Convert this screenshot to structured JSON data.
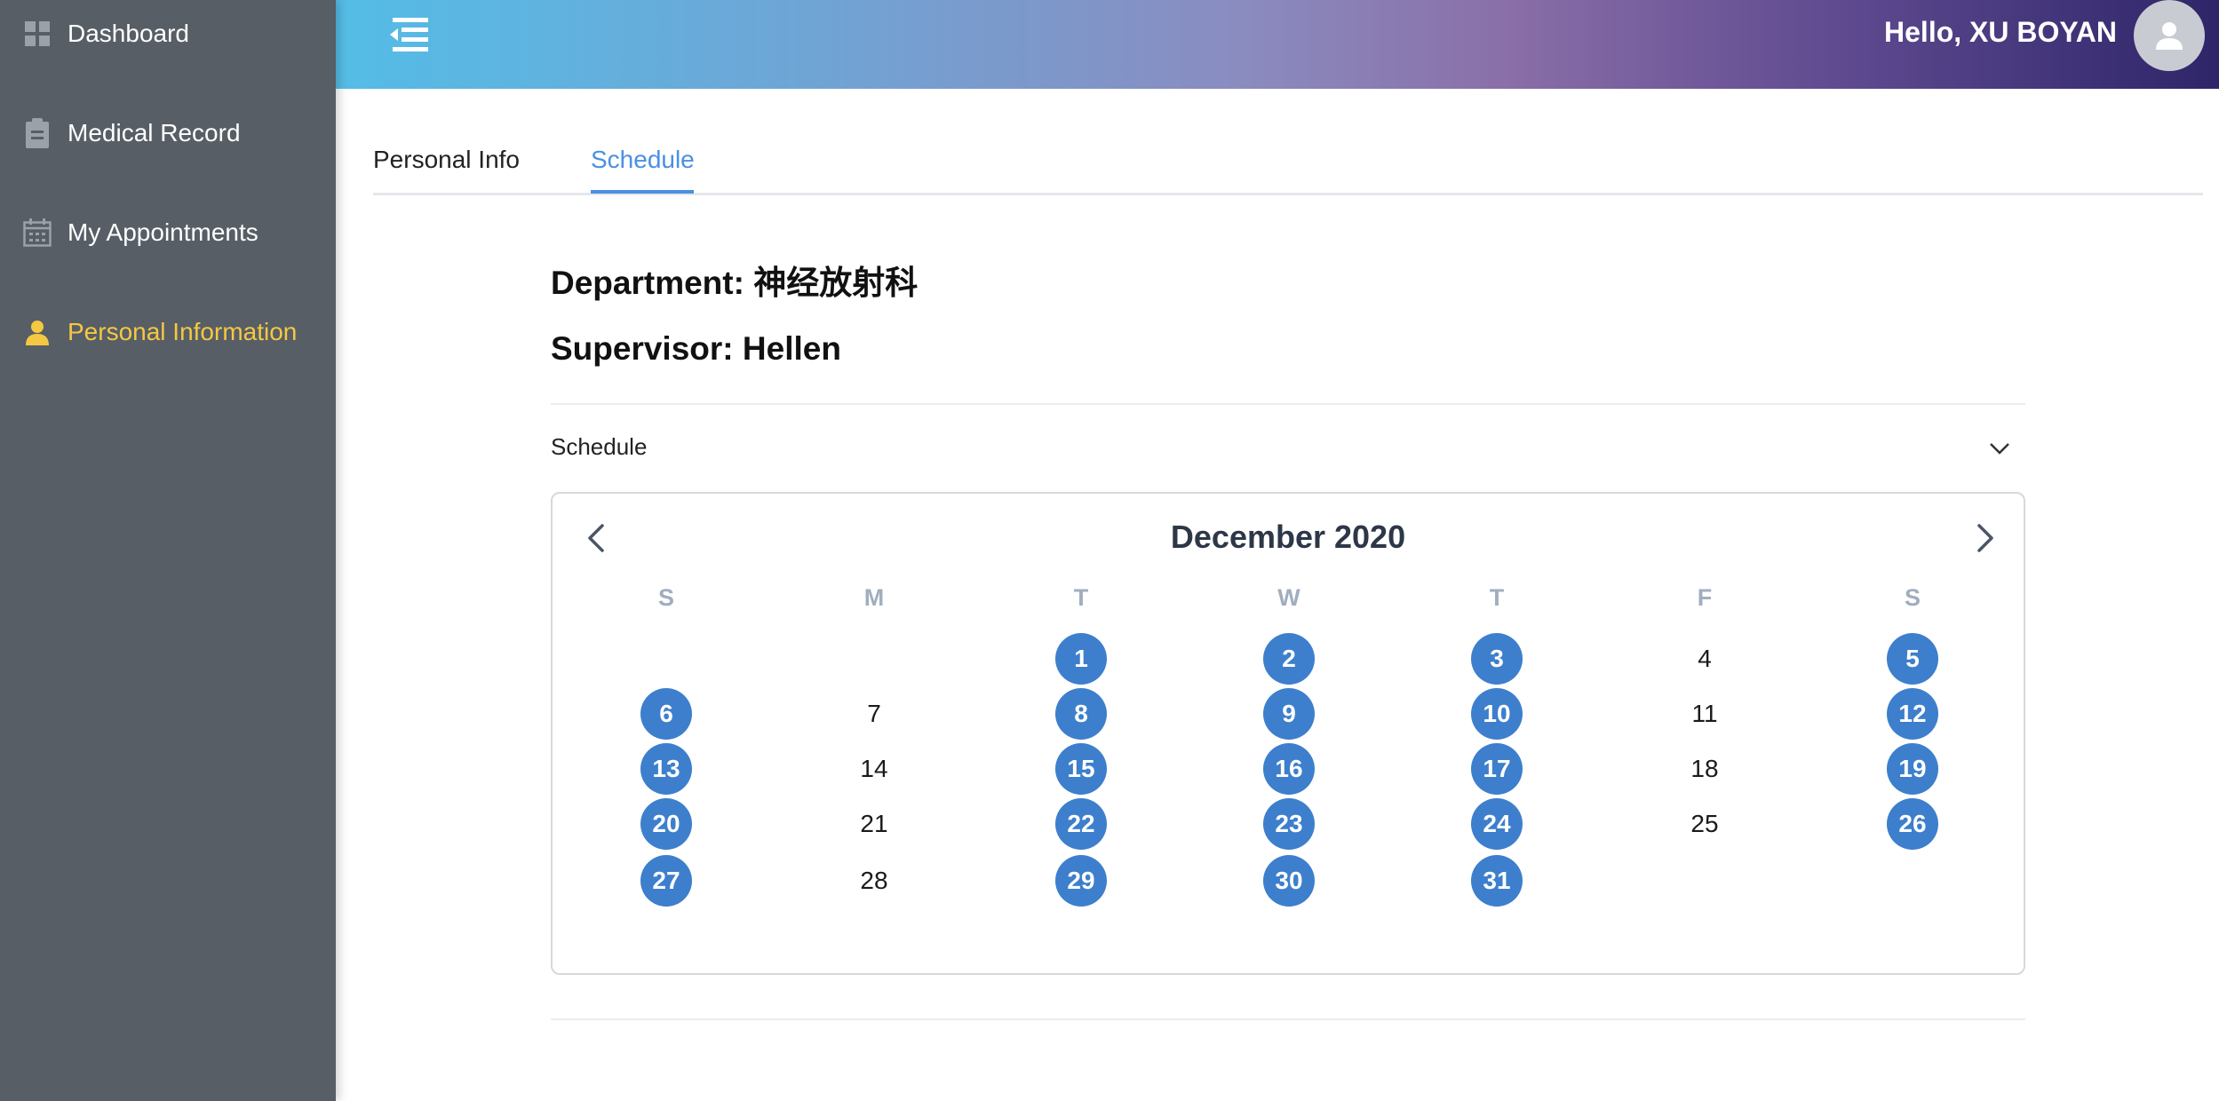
{
  "sidebar": {
    "items": [
      {
        "label": "Dashboard",
        "icon": "grid-icon",
        "active": false
      },
      {
        "label": "Medical Record",
        "icon": "clipboard-icon",
        "active": false
      },
      {
        "label": "My Appointments",
        "icon": "calendar-icon",
        "active": false
      },
      {
        "label": "Personal Information",
        "icon": "user-icon",
        "active": true
      }
    ]
  },
  "header": {
    "greeting": "Hello, XU BOYAN",
    "menu_icon": "menu-collapse-icon",
    "avatar_icon": "user-avatar-icon"
  },
  "tabs": [
    {
      "label": "Personal Info",
      "active": false
    },
    {
      "label": "Schedule",
      "active": true
    }
  ],
  "info": {
    "department": "Department: 神经放射科",
    "supervisor": "Supervisor: Hellen"
  },
  "collapse": {
    "title": "Schedule",
    "icon": "chevron-down-icon"
  },
  "calendar": {
    "title": "December 2020",
    "weekdays": [
      "S",
      "M",
      "T",
      "W",
      "T",
      "F",
      "S"
    ],
    "first_weekday_index": 2,
    "days_in_month": 31,
    "scheduled_days": [
      1,
      2,
      3,
      5,
      6,
      8,
      9,
      10,
      12,
      13,
      15,
      16,
      17,
      19,
      20,
      22,
      23,
      24,
      26,
      27,
      29,
      30,
      31
    ]
  },
  "colors": {
    "sidebar_bg": "#575e66",
    "active_nav": "#f5c842",
    "accent_blue": "#4a90e2",
    "scheduled_day": "#3d7fcc"
  }
}
